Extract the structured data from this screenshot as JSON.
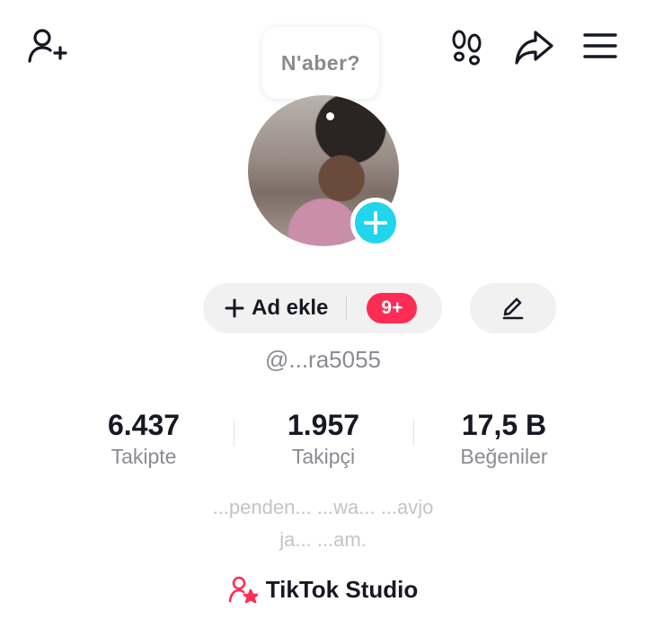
{
  "top_bar": {
    "add_friend_icon": "person-plus-icon",
    "footprints_icon": "footprints-icon",
    "share_icon": "share-arrow-icon",
    "menu_icon": "hamburger-menu-icon"
  },
  "note_bubble": {
    "text": "N'aber?"
  },
  "profile": {
    "add_photo_icon": "plus-icon",
    "username": "@...ra5055"
  },
  "actions": {
    "ad_label": "Ad ekle",
    "notification_count": "9+",
    "edit_icon": "pencil-icon"
  },
  "stats": [
    {
      "value": "6.437",
      "label": "Takipte"
    },
    {
      "value": "1.957",
      "label": "Takipçi"
    },
    {
      "value": "17,5 B",
      "label": "Beğeniler"
    }
  ],
  "bio": {
    "line1": "...penden... ...wa... ...avjo",
    "line2": "ja... ...am."
  },
  "studio": {
    "label": "TikTok Studio",
    "icon": "studio-person-star-icon"
  },
  "colors": {
    "accent_pink": "#fe2c55",
    "accent_cyan": "#20d5ec"
  }
}
